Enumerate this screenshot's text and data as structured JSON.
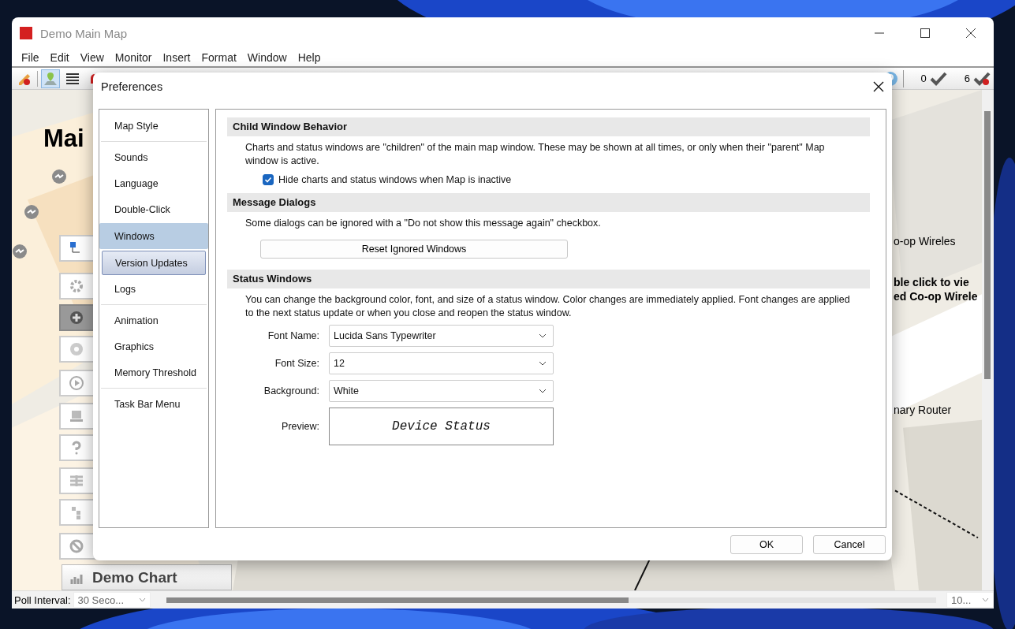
{
  "window": {
    "title": "Demo Main Map",
    "menu": [
      "File",
      "Edit",
      "View",
      "Monitor",
      "Insert",
      "Format",
      "Window",
      "Help"
    ]
  },
  "toolbar": {
    "check_count": "0",
    "alert_count": "6"
  },
  "map": {
    "title": "Mai",
    "labels": [
      {
        "text": "o-op Wireles",
        "bold": false
      },
      {
        "text": "ble click to vie",
        "bold": true
      },
      {
        "text": "ed Co-op Wirele",
        "bold": true
      },
      {
        "text": "nary Router",
        "bold": false
      }
    ],
    "chart_button": "Demo Chart"
  },
  "preferences": {
    "title": "Preferences",
    "nav": [
      {
        "items": [
          {
            "label": "Map Style",
            "selected": false,
            "hovered": false
          }
        ]
      },
      {
        "items": [
          {
            "label": "Sounds",
            "selected": false,
            "hovered": false
          },
          {
            "label": "Language",
            "selected": false,
            "hovered": false
          },
          {
            "label": "Double-Click",
            "selected": false,
            "hovered": false
          },
          {
            "label": "Windows",
            "selected": true,
            "hovered": false
          },
          {
            "label": "Version Updates",
            "selected": false,
            "hovered": true
          },
          {
            "label": "Logs",
            "selected": false,
            "hovered": false
          }
        ]
      },
      {
        "items": [
          {
            "label": "Animation",
            "selected": false,
            "hovered": false
          },
          {
            "label": "Graphics",
            "selected": false,
            "hovered": false
          },
          {
            "label": "Memory Threshold",
            "selected": false,
            "hovered": false
          }
        ]
      },
      {
        "items": [
          {
            "label": "Task Bar Menu",
            "selected": false,
            "hovered": false
          }
        ]
      }
    ],
    "sections": [
      {
        "kind": "checkbox",
        "heading": "Child Window Behavior",
        "text": "Charts and status windows are \"children\" of the main map window.  These may be shown at all times, or only when their \"parent\" Map window is active.",
        "checkbox": {
          "label": "Hide charts and status windows when Map is inactive",
          "checked": true
        }
      },
      {
        "kind": "button",
        "heading": "Message Dialogs",
        "text": "Some dialogs can be ignored with a \"Do not show this message again\" checkbox.",
        "button": "Reset Ignored Windows"
      },
      {
        "kind": "form",
        "heading": "Status Windows",
        "text": "You can change the background color, font, and size of a status window. Color changes are immediately applied. Font changes are applied to the next status update or when you close and reopen the status window.",
        "fields": [
          {
            "label": "Font Name:",
            "value": "Lucida Sans Typewriter"
          },
          {
            "label": "Font Size:",
            "value": "12"
          },
          {
            "label": "Background:",
            "value": "White"
          }
        ],
        "preview": {
          "label": "Preview:",
          "text": "Device Status"
        }
      }
    ],
    "buttons": [
      "OK",
      "Cancel"
    ]
  },
  "status_bar": {
    "poll_label": "Poll Interval:",
    "poll_value": "30 Seco...",
    "zoom_value": "10..."
  }
}
